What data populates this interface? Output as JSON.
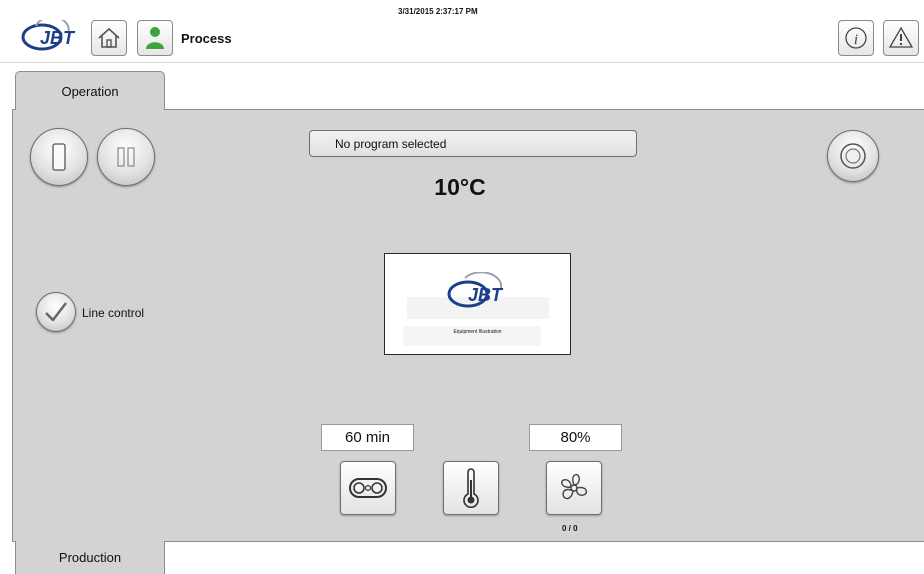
{
  "header": {
    "logo_text": "JBT",
    "process_label": "Process",
    "datetime": "3/31/2015 2:37:17 PM",
    "icons": {
      "home": "home-icon",
      "user": "user-icon",
      "info": "info-icon",
      "warning": "warning-icon"
    }
  },
  "tabs": {
    "top": "Operation",
    "bottom": "Production"
  },
  "operation": {
    "program_status": "No program selected",
    "temperature": "10°C",
    "line_control_label": "Line control",
    "illustration_caption": "Equipment Illustration",
    "illustration_logo": "JBT",
    "time_value": "60 min",
    "fan_value": "80%",
    "fan_count": "0 / 0",
    "icons": {
      "start": "start-icon",
      "pause": "pause-icon",
      "stop": "stop-icon",
      "line_control": "checkmark-icon",
      "belt": "conveyor-belt-icon",
      "thermometer": "thermometer-icon",
      "fan": "fan-icon"
    }
  }
}
